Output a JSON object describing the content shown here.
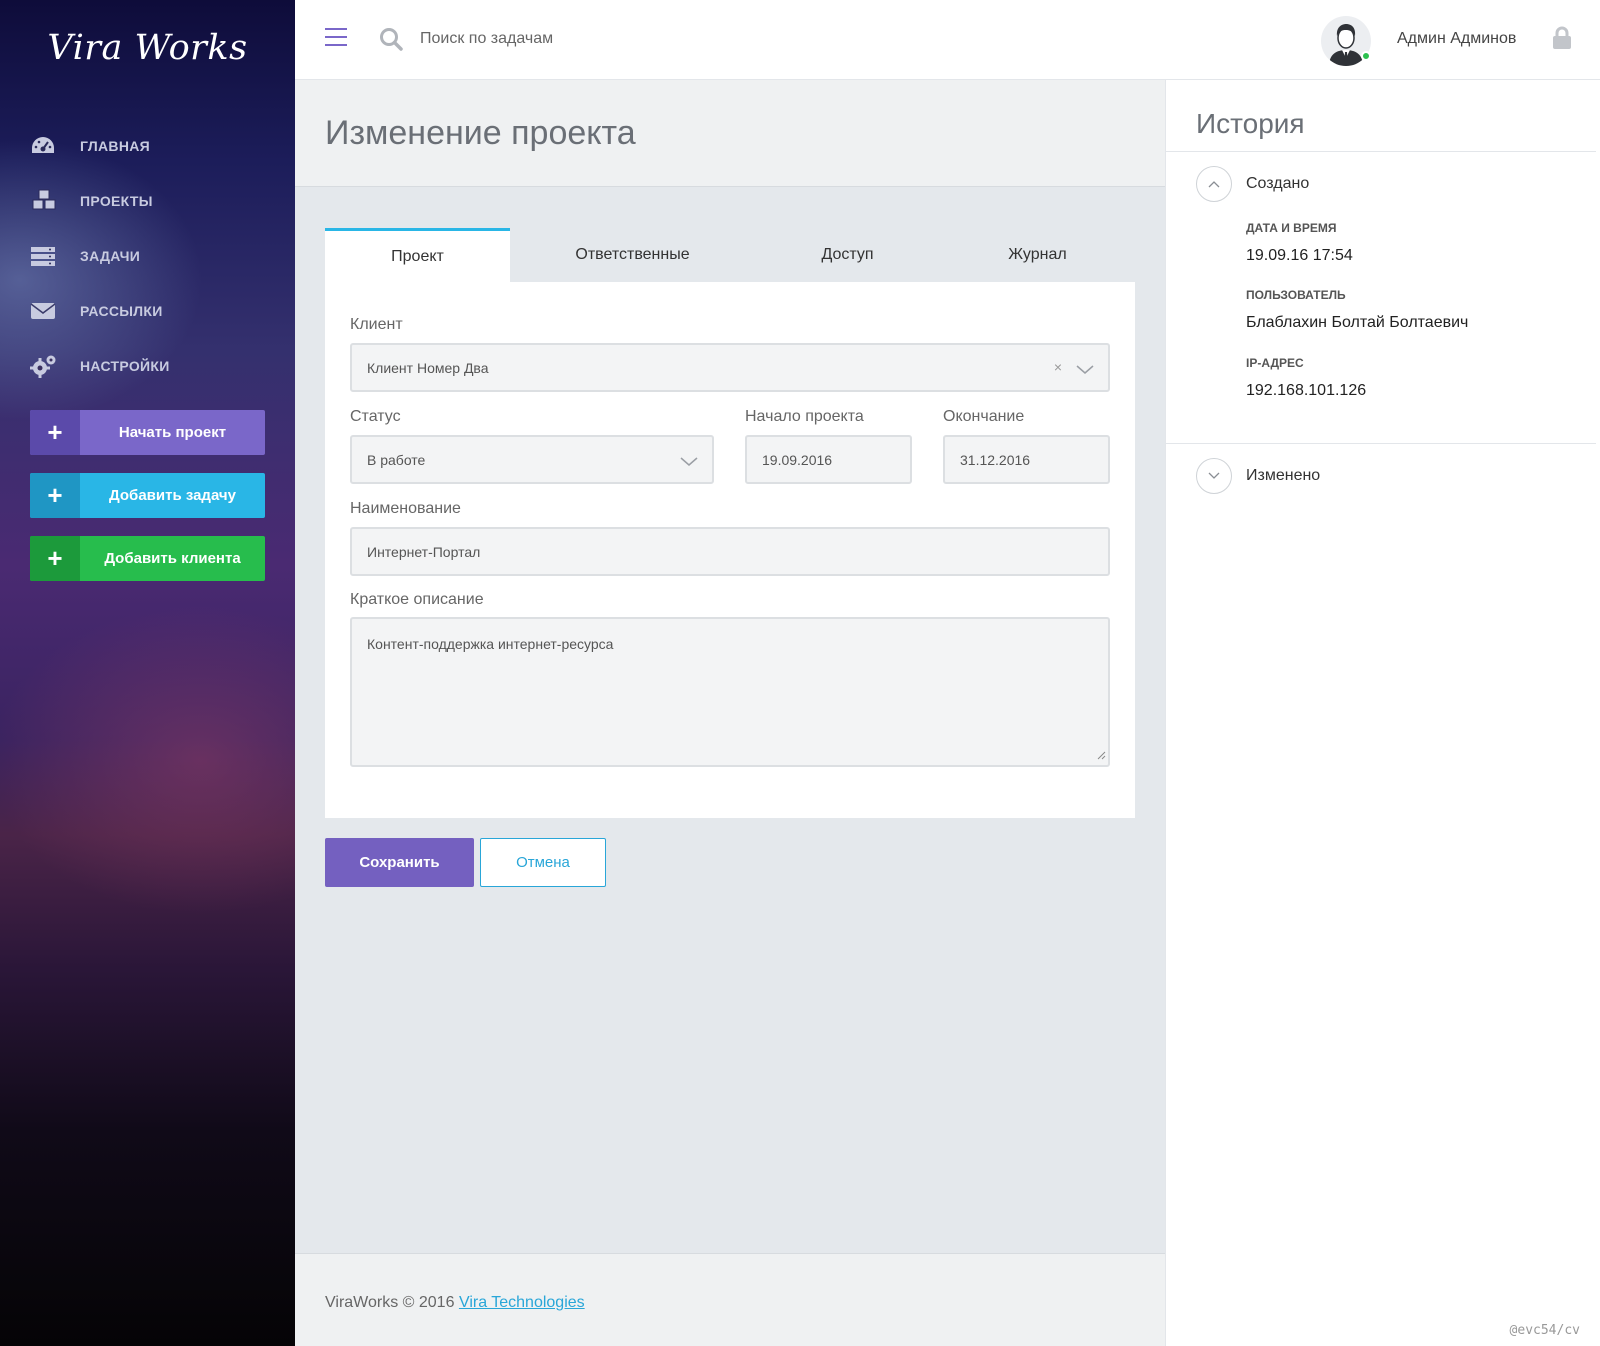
{
  "brand": {
    "logo": "Vira Works"
  },
  "sidebar": {
    "items": [
      {
        "label": "ГЛАВНАЯ",
        "icon": "dashboard-icon"
      },
      {
        "label": "ПРОЕКТЫ",
        "icon": "cubes-icon"
      },
      {
        "label": "ЗАДАЧИ",
        "icon": "server-icon"
      },
      {
        "label": "РАССЫЛКИ",
        "icon": "envelope-icon"
      },
      {
        "label": "НАСТРОЙКИ",
        "icon": "gears-icon"
      }
    ],
    "actions": [
      {
        "label": "Начать проект",
        "plus": "+",
        "color": "#7a67c9"
      },
      {
        "label": "Добавить задачу",
        "plus": "+",
        "color": "#29b6e6"
      },
      {
        "label": "Добавить клиента",
        "plus": "+",
        "color": "#27bd4d"
      }
    ]
  },
  "topbar": {
    "search_placeholder": "Поиск по задачам",
    "user_name": "Админ Админов"
  },
  "page": {
    "title": "Изменение проекта"
  },
  "tabs": [
    {
      "label": "Проект",
      "active": true
    },
    {
      "label": "Ответственные",
      "active": false
    },
    {
      "label": "Доступ",
      "active": false
    },
    {
      "label": "Журнал",
      "active": false
    }
  ],
  "form": {
    "client": {
      "label": "Клиент",
      "value": "Клиент Номер Два",
      "clear": "×"
    },
    "status": {
      "label": "Статус",
      "value": "В работе"
    },
    "start": {
      "label": "Начало проекта",
      "value": "19.09.2016"
    },
    "end": {
      "label": "Окончание",
      "value": "31.12.2016"
    },
    "name": {
      "label": "Наименование",
      "value": "Интернет-Портал"
    },
    "description": {
      "label": "Краткое описание",
      "value": "Контент-поддержка интернет-ресурса"
    }
  },
  "buttons": {
    "save": "Сохранить",
    "cancel": "Отмена"
  },
  "footer": {
    "text": "ViraWorks © 2016",
    "link": "Vira Technologies"
  },
  "history": {
    "title": "История",
    "created": {
      "heading": "Создано",
      "date_label": "ДАТА И ВРЕМЯ",
      "date_value": "19.09.16 17:54",
      "user_label": "ПОЛЬЗОВАТЕЛЬ",
      "user_value": "Блаблахин Болтай Болтаевич",
      "ip_label": "IP-АДРЕС",
      "ip_value": "192.168.101.126"
    },
    "changed": {
      "heading": "Изменено"
    }
  },
  "watermark": "@evc54/cv",
  "colors": {
    "accent": "#7460c0",
    "link": "#29a6d8",
    "online": "#2bc04f"
  }
}
